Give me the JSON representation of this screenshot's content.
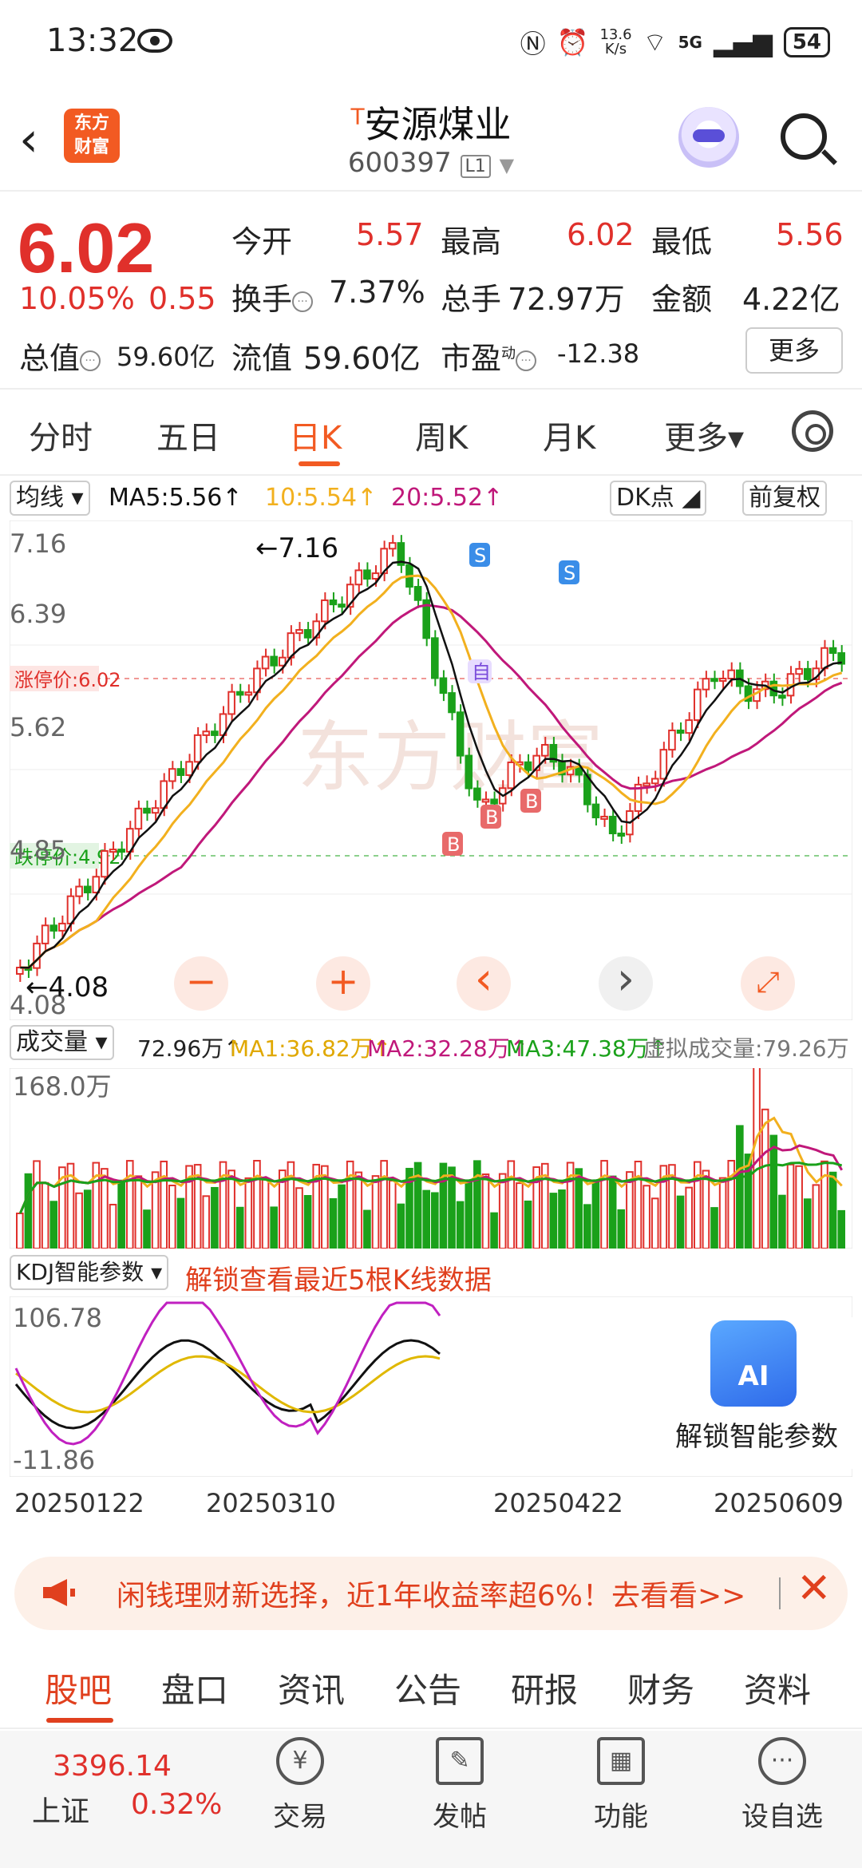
{
  "status_bar": {
    "time": "13:32",
    "net_speed_value": "13.6",
    "net_speed_unit": "K/s",
    "signal": "5G",
    "battery": "54"
  },
  "header": {
    "title": "安源煤业",
    "title_mark": "T",
    "code": "600397",
    "code_tag": "L1",
    "logo_line1": "东方",
    "logo_line2": "财富"
  },
  "quote": {
    "price": "6.02",
    "change_pct": "10.05%",
    "change": "0.55",
    "open_label": "今开",
    "open": "5.57",
    "high_label": "最高",
    "high": "6.02",
    "low_label": "最低",
    "low": "5.56",
    "turnover_label": "换手",
    "turnover": "7.37%",
    "volume_label": "总手",
    "volume": "72.97万",
    "amount_label": "金额",
    "amount": "4.22亿",
    "mktcap_label": "总值",
    "mktcap": "59.60亿",
    "float_label": "流值",
    "float_cap": "59.60亿",
    "pe_label": "市盈",
    "pe_sup": "动",
    "pe": "-12.38",
    "more": "更多"
  },
  "tabs": [
    {
      "label": "分时",
      "active": false
    },
    {
      "label": "五日",
      "active": false
    },
    {
      "label": "日K",
      "active": true
    },
    {
      "label": "周K",
      "active": false
    },
    {
      "label": "月K",
      "active": false
    },
    {
      "label": "更多▾",
      "active": false
    }
  ],
  "ma_bar": {
    "selector": "均线",
    "ma5": "MA5:5.56↑",
    "ma10": "10:5.54↑",
    "ma20": "20:5.52↑",
    "dk": "DK点",
    "adjust": "前复权"
  },
  "colors": {
    "up": "#e0302b",
    "down": "#1aa11a",
    "accent": "#f25a22",
    "ma5": "#111111",
    "ma10": "#f2b01e",
    "ma20": "#c0187a",
    "limit": "#e0302b"
  },
  "chart": {
    "y_top": "7.16",
    "y_mid1": "6.39",
    "y_mid2": "5.62",
    "y_mid3": "4.85",
    "y_bottom": "4.08",
    "high_marker": "←7.16",
    "low_marker": "←4.08",
    "limit_up_label": "涨停价:6.02",
    "limit_down_label": "跌停价:4.92",
    "watermark": "东方财富"
  },
  "chart_controls": {
    "minus": "−",
    "plus": "+",
    "prev": "‹",
    "next": "›"
  },
  "volume": {
    "selector": "成交量",
    "value": "72.96万↑",
    "ma1": "MA1:36.82万↑",
    "ma2": "MA2:32.28万↑",
    "ma3": "MA3:47.38万↑",
    "virtual": "虚拟成交量:79.26万",
    "y_max": "168.0万"
  },
  "kdj": {
    "selector": "KDJ智能参数",
    "unlock_text": "解锁查看最近5根K线数据",
    "y_max": "106.78",
    "y_min": "-11.86",
    "ai_icon": "AI",
    "ai_label": "解锁智能参数"
  },
  "dates": [
    "20250122",
    "20250310",
    "20250422",
    "20250609"
  ],
  "promo": {
    "text": "闲钱理财新选择，近1年收益率超6%！去看看>>",
    "close": "✕"
  },
  "content_tabs": [
    "股吧",
    "盘口",
    "资讯",
    "公告",
    "研报",
    "财务",
    "资料"
  ],
  "bottom": {
    "index_value": "3396.14",
    "index_name": "上证",
    "index_pct": "0.32%",
    "nav": [
      {
        "label": "交易",
        "icon": "yen-cycle-icon"
      },
      {
        "label": "发帖",
        "icon": "edit-icon"
      },
      {
        "label": "功能",
        "icon": "grid-icon"
      },
      {
        "label": "设自选",
        "icon": "more-dots-icon"
      }
    ]
  }
}
